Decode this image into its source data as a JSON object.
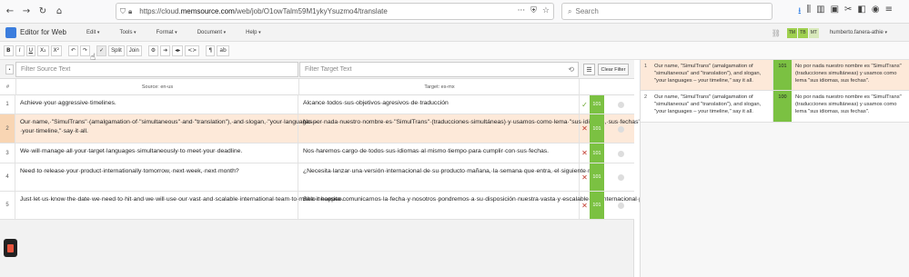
{
  "browser": {
    "url_prefix": "https://cloud.",
    "url_domain": "memsource.com",
    "url_path": "/web/job/O1owTalm59M1ykyYsuzmo4/translate",
    "search_placeholder": "Search"
  },
  "app": {
    "title": "Editor for Web",
    "menu": [
      "Edit",
      "Tools",
      "Format",
      "Document",
      "Help"
    ],
    "modes": [
      "TM",
      "TB",
      "MT"
    ],
    "user": "humberto.fanera-athie"
  },
  "toolbar": {
    "buttons": [
      "B",
      "I",
      "U",
      "X₂",
      "X²",
      "↶",
      "↷",
      "✓",
      "Split",
      "Join",
      "⚙",
      "➔",
      "◂▸",
      "<>",
      "¶",
      "ab"
    ]
  },
  "filters": {
    "source_placeholder": "Filter Source Text",
    "target_placeholder": "Filter Target Text",
    "clear_label": "Clear Filter"
  },
  "grid": {
    "header_num": "#",
    "header_source": "Source: en-us",
    "header_target": "Target: es-mx",
    "rows": [
      {
        "num": "1",
        "source": "Achieve·your·aggressive·timelines.",
        "target": "Alcance·todos·sus·objetivos·agresivos·de·traducción",
        "status": "✓",
        "score": "101"
      },
      {
        "num": "2",
        "source": "Our·name,·\"SimulTrans\"·(amalgamation·of·\"simultaneous\"·and·\"translation\"),·and·slogan,·\"your·languages·–·your·timeline,\"·say·it·all.",
        "target": "No·por·nada·nuestro·nombre·es·\"SimulTrans\"·(traducciones·simultáneas)·y·usamos·como·lema·\"sus·idiomas,·sus·fechas\".",
        "status": "✕",
        "score": "101"
      },
      {
        "num": "3",
        "source": "We·will·manage·all·your·target·languages·simultaneously·to·meet·your·deadline.",
        "target": "Nos·haremos·cargo·de·todos·sus·idiomas·al·mismo·tiempo·para·cumplir·con·sus·fechas.",
        "status": "✕",
        "score": "101"
      },
      {
        "num": "4",
        "source": "Need·to·release·your·product·internationally·tomorrow,·next·week,·next·month?",
        "target": "¿Necesita·lanzar·una·versión·internacional·de·su·producto·mañana,·la·semana·que·entra,·el·siguiente·mes?",
        "status": "✕",
        "score": "101"
      },
      {
        "num": "5",
        "source": "Just·let·us·know·the·date·we·need·to·hit·and·we·will·use·our·vast·and·scalable·international·team·to·make·it·happen.",
        "target": "Solo·necesita·comunicarnos·la·fecha·y·nosotros·pondremos·a·su·disposición·nuestra·vasta·y·escalable·red·internacional·para·hacerla·realidad.",
        "status": "✕",
        "score": "101"
      }
    ]
  },
  "tm_matches": [
    {
      "num": "1",
      "source": "Our name, \"SimulTrans\" (amalgamation of \"simultaneous\" and \"translation\"), and slogan, \"your languages – your timeline,\" say it all.",
      "score": "101",
      "target": "No por nada nuestro nombre es \"SimulTrans\" (traducciones simultáneas) y usamos como lema \"sus idiomas, sus fechas\"."
    },
    {
      "num": "2",
      "source": "Our name, \"SimulTrans\" (amalgamation of \"simultaneous\" and \"translation\"), and slogan, \"your languages – your timeline,\" say it all.",
      "score": "100",
      "target": "No por nada nuestro nombre es \"SimulTrans\" (traducciones simultáneas) y usamos como lema \"sus idiomas, sus fechas\"."
    }
  ]
}
